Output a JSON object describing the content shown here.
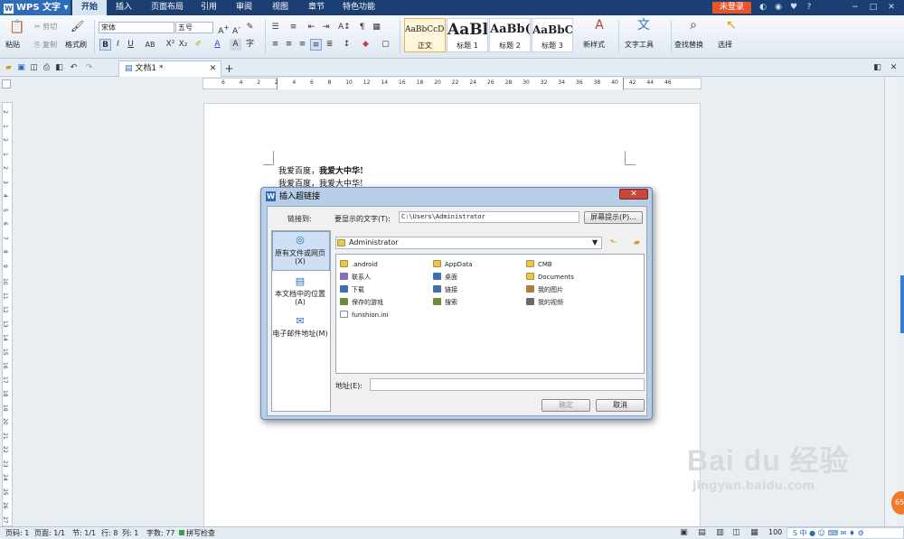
{
  "app": {
    "name": "WPS 文字",
    "login": "未登录"
  },
  "menu_tabs": [
    "开始",
    "插入",
    "页面布局",
    "引用",
    "审阅",
    "视图",
    "章节",
    "特色功能"
  ],
  "ribbon": {
    "paste": "粘贴",
    "cut": "剪切",
    "copy": "复制",
    "format_painter": "格式刷",
    "font_name": "宋体",
    "font_size": "五号",
    "styles": [
      {
        "sample": "AaBbCcDd",
        "name": "正文"
      },
      {
        "sample": "AaBl",
        "name": "标题 1"
      },
      {
        "sample": "AaBb(",
        "name": "标题 2"
      },
      {
        "sample": "AaBbC",
        "name": "标题 3"
      }
    ],
    "new_style": "新样式",
    "text_tools": "文字工具",
    "find_replace": "查找替换",
    "select": "选择"
  },
  "doc_tab": {
    "title": "文档1 *"
  },
  "ruler_numbers_h": [
    "6",
    "4",
    "2",
    "2",
    "4",
    "6",
    "8",
    "10",
    "12",
    "14",
    "16",
    "18",
    "20",
    "22",
    "24",
    "26",
    "28",
    "30",
    "32",
    "34",
    "36",
    "38",
    "40",
    "42",
    "44",
    "46"
  ],
  "document": {
    "line1_plain": "我爱百度，",
    "line1_bold": "我爱大中华!",
    "line2": "我爱百度，我爱大中华!"
  },
  "dialog": {
    "title": "插入超链接",
    "link_to": "链接到:",
    "display_text_label": "要显示的文字(T):",
    "display_text_value": "C:\\Users\\Administrator",
    "screentip_btn": "屏幕提示(P)...",
    "side": [
      {
        "label": "原有文件或网页(X)",
        "icon": "globe-file-icon"
      },
      {
        "label": "本文档中的位置(A)",
        "icon": "document-place-icon"
      },
      {
        "label": "电子邮件地址(M)",
        "icon": "email-icon"
      }
    ],
    "folder": "Administrator",
    "files": [
      [
        ".android",
        "AppData",
        "CMB"
      ],
      [
        "联系人",
        "桌面",
        "Documents"
      ],
      [
        "下载",
        "链接",
        "我的图片"
      ],
      [
        "保存的游戏",
        "搜索",
        "我的视频"
      ],
      [
        "funshion.ini"
      ]
    ],
    "address_label": "地址(E):",
    "address_value": "",
    "ok": "确定",
    "cancel": "取消"
  },
  "status": {
    "page": "页码: 1",
    "pages": "页面: 1/1",
    "section": "节: 1/1",
    "row": "行: 8",
    "col": "列: 1",
    "words": "字数: 77",
    "spell": "拼写检查",
    "zoom": "100"
  },
  "watermark": {
    "brand": "Bai du 经验",
    "url": "jingyan.baidu.com"
  }
}
